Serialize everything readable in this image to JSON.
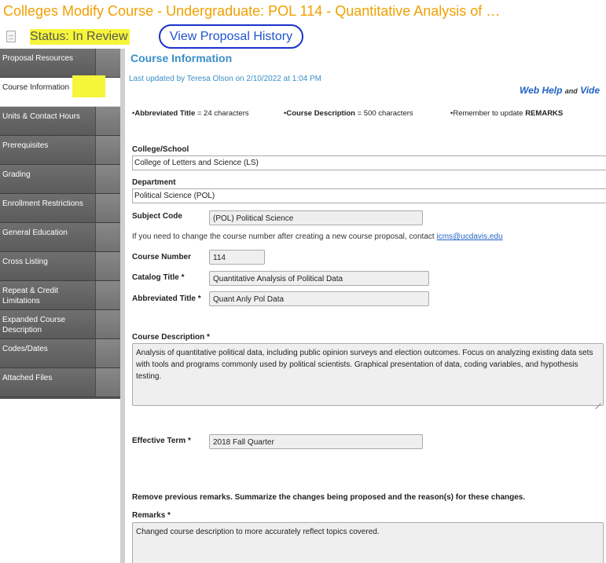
{
  "header": {
    "title": "Colleges Modify Course - Undergraduate: POL 114 - Quantitative Analysis of …",
    "status": "Status: In Review",
    "history_link": "View Proposal History"
  },
  "sidebar": {
    "items": [
      {
        "label": "Proposal Resources"
      },
      {
        "label": "Course Information"
      },
      {
        "label": "Units & Contact Hours"
      },
      {
        "label": "Prerequisites"
      },
      {
        "label": "Grading"
      },
      {
        "label": "Enrollment Restrictions"
      },
      {
        "label": "General Education"
      },
      {
        "label": "Cross Listing"
      },
      {
        "label": "Repeat & Credit Limitations"
      },
      {
        "label": "Expanded Course Description"
      },
      {
        "label": "Codes/Dates"
      },
      {
        "label": "Attached Files"
      }
    ],
    "active_index": 1
  },
  "main": {
    "section_title": "Course Information",
    "last_updated": "Last updated by Teresa Olson on 2/10/2022 at 1:04 PM",
    "help": {
      "web_help": "Web Help",
      "and": "and",
      "video": "Vide"
    },
    "notes": {
      "abbrev_label": "Abbreviated Title",
      "abbrev_value": " = 24 characters",
      "desc_label": "Course Description",
      "desc_value": " = 500 characters",
      "remember": "Remember to update ",
      "remarks_word": "REMARKS"
    },
    "college": {
      "label": "College/School",
      "value": "College of Letters and Science (LS)"
    },
    "department": {
      "label": "Department",
      "value": "Political Science (POL)"
    },
    "subject_code": {
      "label": "Subject Code",
      "value": "(POL) Political Science"
    },
    "course_number_info": {
      "text": "If you need to change the course number after creating a new course proposal, contact ",
      "email": "icms@ucdavis.edu"
    },
    "course_number": {
      "label": "Course Number",
      "value": "114"
    },
    "catalog_title": {
      "label": "Catalog Title *",
      "value": "Quantitative Analysis of Political Data"
    },
    "abbreviated_title": {
      "label": "Abbreviated Title *",
      "value": "Quant Anly Pol Data"
    },
    "course_description": {
      "label": "Course Description *",
      "value": "Analysis of quantitative political data, including public opinion surveys and election outcomes. Focus on analyzing existing data sets with tools and programs commonly used by political scientists. Graphical presentation of data, coding variables, and hypothesis testing."
    },
    "effective_term": {
      "label": "Effective Term *",
      "value": "2018 Fall Quarter"
    },
    "remarks_instruction": "Remove previous remarks. Summarize the changes being proposed and the reason(s) for these changes.",
    "remarks": {
      "label": "Remarks *",
      "value": "Changed course description to more accurately reflect topics covered."
    }
  },
  "colors": {
    "title": "#f0a000",
    "link": "#1f63c4",
    "highlight": "#f5f53a",
    "nav_bg": "#5b5b5b",
    "section_title": "#3a8fc7"
  }
}
